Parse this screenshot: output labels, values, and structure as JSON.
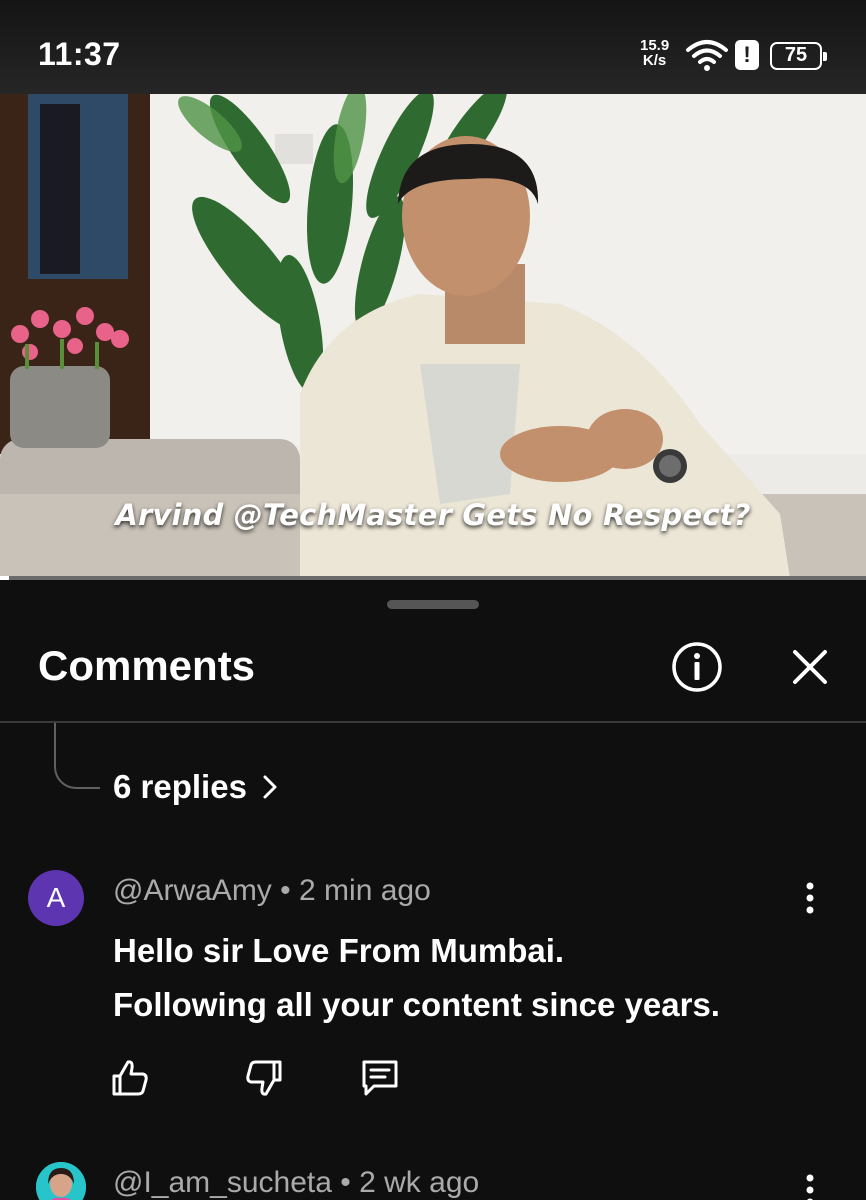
{
  "status_bar": {
    "time": "11:37",
    "net_speed_value": "15.9",
    "net_speed_unit": "K/s",
    "wifi_icon": "wifi-icon",
    "alert_icon": "alert-icon",
    "alert_text": "!",
    "battery": "75"
  },
  "video": {
    "caption": "Arvind @TechMaster Gets No Respect?",
    "progress_fraction": 0.01
  },
  "sheet": {
    "title": "Comments",
    "info_icon": "info-icon",
    "close_icon": "close-icon"
  },
  "thread": {
    "replies_label": "6 replies",
    "replies_icon": "chevron-right-icon"
  },
  "comments": [
    {
      "avatar_letter": "A",
      "avatar_color": "#5e35b1",
      "author": "@ArwaAmy",
      "separator": "•",
      "time": "2 min ago",
      "lines": [
        "Hello sir Love From Mumbai.",
        "Following all your content since years."
      ],
      "actions": [
        "like-icon",
        "dislike-icon",
        "reply-icon"
      ]
    },
    {
      "author": "@I_am_sucheta",
      "separator": "•",
      "time": "2 wk ago"
    }
  ],
  "colors": {
    "background": "#0f0f0f",
    "text_primary": "#f1f1f1",
    "text_secondary": "#aaaaaa",
    "divider": "#3a3a3a"
  }
}
